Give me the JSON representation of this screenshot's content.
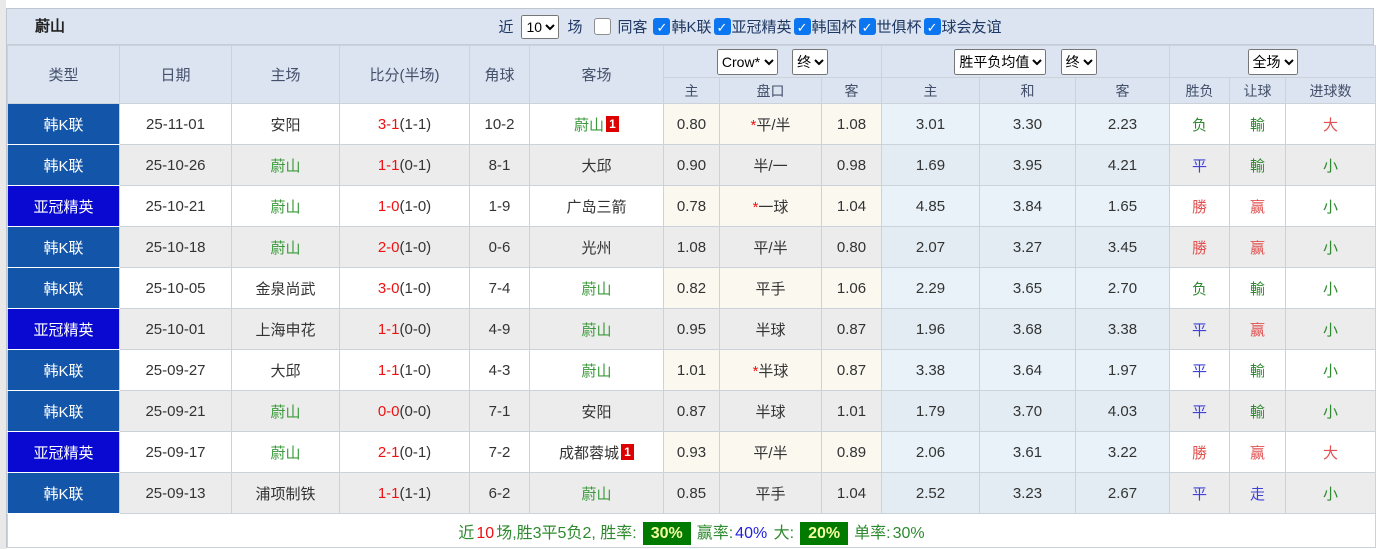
{
  "title": "蔚山",
  "filter_bar": {
    "recent_label": "近",
    "recent_value": "10",
    "matches_label": "场",
    "same_opponent": {
      "label": "同客",
      "checked": false
    },
    "leagues": [
      {
        "label": "韩K联",
        "checked": true
      },
      {
        "label": "亚冠精英",
        "checked": true
      },
      {
        "label": "韩国杯",
        "checked": true
      },
      {
        "label": "世俱杯",
        "checked": true
      },
      {
        "label": "球会友谊",
        "checked": true
      }
    ]
  },
  "table": {
    "main_headers": [
      "类型",
      "日期",
      "主场",
      "比分(半场)",
      "角球",
      "客场"
    ],
    "sub_headers": [
      "主",
      "盘口",
      "客",
      "主",
      "和",
      "客",
      "胜负",
      "让球",
      "进球数"
    ],
    "selects": {
      "odds_company": "Crow*",
      "odds_time_1": "终",
      "avg_mode": "胜平负均值",
      "odds_time_2": "终",
      "scope": "全场"
    },
    "rows": [
      {
        "league": "韩K联",
        "league_type": "kl",
        "date": "25-11-01",
        "home": "安阳",
        "home_team": false,
        "home_badge": "",
        "score": "3-1",
        "half": "(1-1)",
        "corner": "10-2",
        "away": "蔚山",
        "away_team": true,
        "away_badge": "1",
        "odds_home": "0.80",
        "handicap": "平/半",
        "star": true,
        "odds_away": "1.08",
        "avg_home": "3.01",
        "avg_draw": "3.30",
        "avg_away": "2.23",
        "result": {
          "text": "负",
          "color": "green"
        },
        "handicap_result": {
          "text": "輸",
          "color": "green"
        },
        "goals": {
          "text": "大",
          "color": "red"
        }
      },
      {
        "league": "韩K联",
        "league_type": "kl",
        "date": "25-10-26",
        "home": "蔚山",
        "home_team": true,
        "home_badge": "",
        "score": "1-1",
        "half": "(0-1)",
        "corner": "8-1",
        "away": "大邱",
        "away_team": false,
        "away_badge": "",
        "odds_home": "0.90",
        "handicap": "半/一",
        "star": false,
        "odds_away": "0.98",
        "avg_home": "1.69",
        "avg_draw": "3.95",
        "avg_away": "4.21",
        "result": {
          "text": "平",
          "color": "blue"
        },
        "handicap_result": {
          "text": "輸",
          "color": "green"
        },
        "goals": {
          "text": "小",
          "color": "green"
        }
      },
      {
        "league": "亚冠精英",
        "league_type": "acl",
        "date": "25-10-21",
        "home": "蔚山",
        "home_team": true,
        "home_badge": "",
        "score": "1-0",
        "half": "(1-0)",
        "corner": "1-9",
        "away": "广岛三箭",
        "away_team": false,
        "away_badge": "",
        "odds_home": "0.78",
        "handicap": "一球",
        "star": true,
        "odds_away": "1.04",
        "avg_home": "4.85",
        "avg_draw": "3.84",
        "avg_away": "1.65",
        "result": {
          "text": "勝",
          "color": "red"
        },
        "handicap_result": {
          "text": "赢",
          "color": "red"
        },
        "goals": {
          "text": "小",
          "color": "green"
        }
      },
      {
        "league": "韩K联",
        "league_type": "kl",
        "date": "25-10-18",
        "home": "蔚山",
        "home_team": true,
        "home_badge": "",
        "score": "2-0",
        "half": "(1-0)",
        "corner": "0-6",
        "away": "光州",
        "away_team": false,
        "away_badge": "",
        "odds_home": "1.08",
        "handicap": "平/半",
        "star": false,
        "odds_away": "0.80",
        "avg_home": "2.07",
        "avg_draw": "3.27",
        "avg_away": "3.45",
        "result": {
          "text": "勝",
          "color": "red"
        },
        "handicap_result": {
          "text": "赢",
          "color": "red"
        },
        "goals": {
          "text": "小",
          "color": "green"
        }
      },
      {
        "league": "韩K联",
        "league_type": "kl",
        "date": "25-10-05",
        "home": "金泉尚武",
        "home_team": false,
        "home_badge": "",
        "score": "3-0",
        "half": "(1-0)",
        "corner": "7-4",
        "away": "蔚山",
        "away_team": true,
        "away_badge": "",
        "odds_home": "0.82",
        "handicap": "平手",
        "star": false,
        "odds_away": "1.06",
        "avg_home": "2.29",
        "avg_draw": "3.65",
        "avg_away": "2.70",
        "result": {
          "text": "负",
          "color": "green"
        },
        "handicap_result": {
          "text": "輸",
          "color": "green"
        },
        "goals": {
          "text": "小",
          "color": "green"
        }
      },
      {
        "league": "亚冠精英",
        "league_type": "acl",
        "date": "25-10-01",
        "home": "上海申花",
        "home_team": false,
        "home_badge": "",
        "score": "1-1",
        "half": "(0-0)",
        "corner": "4-9",
        "away": "蔚山",
        "away_team": true,
        "away_badge": "",
        "odds_home": "0.95",
        "handicap": "半球",
        "star": false,
        "odds_away": "0.87",
        "avg_home": "1.96",
        "avg_draw": "3.68",
        "avg_away": "3.38",
        "result": {
          "text": "平",
          "color": "blue"
        },
        "handicap_result": {
          "text": "赢",
          "color": "red"
        },
        "goals": {
          "text": "小",
          "color": "green"
        }
      },
      {
        "league": "韩K联",
        "league_type": "kl",
        "date": "25-09-27",
        "home": "大邱",
        "home_team": false,
        "home_badge": "",
        "score": "1-1",
        "half": "(1-0)",
        "corner": "4-3",
        "away": "蔚山",
        "away_team": true,
        "away_badge": "",
        "odds_home": "1.01",
        "handicap": "半球",
        "star": true,
        "odds_away": "0.87",
        "avg_home": "3.38",
        "avg_draw": "3.64",
        "avg_away": "1.97",
        "result": {
          "text": "平",
          "color": "blue"
        },
        "handicap_result": {
          "text": "輸",
          "color": "green"
        },
        "goals": {
          "text": "小",
          "color": "green"
        }
      },
      {
        "league": "韩K联",
        "league_type": "kl",
        "date": "25-09-21",
        "home": "蔚山",
        "home_team": true,
        "home_badge": "",
        "score": "0-0",
        "half": "(0-0)",
        "corner": "7-1",
        "away": "安阳",
        "away_team": false,
        "away_badge": "",
        "odds_home": "0.87",
        "handicap": "半球",
        "star": false,
        "odds_away": "1.01",
        "avg_home": "1.79",
        "avg_draw": "3.70",
        "avg_away": "4.03",
        "result": {
          "text": "平",
          "color": "blue"
        },
        "handicap_result": {
          "text": "輸",
          "color": "green"
        },
        "goals": {
          "text": "小",
          "color": "green"
        }
      },
      {
        "league": "亚冠精英",
        "league_type": "acl",
        "date": "25-09-17",
        "home": "蔚山",
        "home_team": true,
        "home_badge": "",
        "score": "2-1",
        "half": "(0-1)",
        "corner": "7-2",
        "away": "成都蓉城",
        "away_team": false,
        "away_badge": "1",
        "odds_home": "0.93",
        "handicap": "平/半",
        "star": false,
        "odds_away": "0.89",
        "avg_home": "2.06",
        "avg_draw": "3.61",
        "avg_away": "3.22",
        "result": {
          "text": "勝",
          "color": "red"
        },
        "handicap_result": {
          "text": "赢",
          "color": "red"
        },
        "goals": {
          "text": "大",
          "color": "red"
        }
      },
      {
        "league": "韩K联",
        "league_type": "kl",
        "date": "25-09-13",
        "home": "浦项制铁",
        "home_team": false,
        "home_badge": "",
        "score": "1-1",
        "half": "(1-1)",
        "corner": "6-2",
        "away": "蔚山",
        "away_team": true,
        "away_badge": "",
        "odds_home": "0.85",
        "handicap": "平手",
        "star": false,
        "odds_away": "1.04",
        "avg_home": "2.52",
        "avg_draw": "3.23",
        "avg_away": "2.67",
        "result": {
          "text": "平",
          "color": "blue"
        },
        "handicap_result": {
          "text": "走",
          "color": "blue"
        },
        "goals": {
          "text": "小",
          "color": "green"
        }
      }
    ]
  },
  "footer": {
    "segments": [
      {
        "text": "近",
        "style": "green"
      },
      {
        "text": "10",
        "style": "red"
      },
      {
        "text": "场,胜3平5负2, 胜率:",
        "style": "green"
      },
      {
        "text": "30%",
        "style": "badge"
      },
      {
        "text": "赢率:",
        "style": "green"
      },
      {
        "text": "40%",
        "style": "blue"
      },
      {
        "text": " 大:",
        "style": "green"
      },
      {
        "text": "20%",
        "style": "badge"
      },
      {
        "text": "单率:",
        "style": "green"
      },
      {
        "text": "30%",
        "style": "green"
      }
    ]
  },
  "colors": {
    "kleague_badge": "#1355a8",
    "acl_badge": "#0909d2",
    "header_bg": "#dbe4f0",
    "win_red": "#e25050",
    "draw_blue": "#4040d9",
    "lose_green": "#2f8a2f",
    "score_red": "#ee1111",
    "team_green": "#3a9a3a",
    "summary_badge_green": "#007a00",
    "checkbox_blue": "#0b76ef"
  }
}
